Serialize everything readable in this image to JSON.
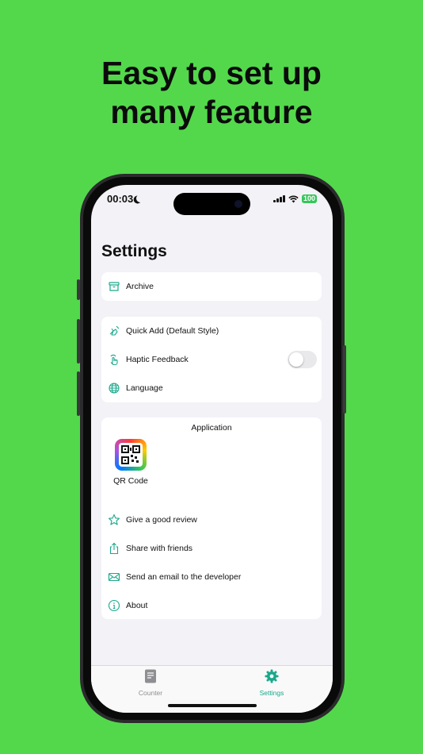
{
  "headline": {
    "line1": "Easy to set up",
    "line2": "many feature"
  },
  "status_bar": {
    "time": "00:03",
    "battery": "100"
  },
  "page_title": "Settings",
  "sections": {
    "archive": {
      "label": "Archive"
    },
    "preferences": {
      "quick_add": "Quick Add (Default Style)",
      "haptic_feedback": "Haptic Feedback",
      "haptic_enabled": false,
      "language": "Language"
    },
    "application": {
      "title": "Application",
      "qr_code_label": "QR Code",
      "items": {
        "review": "Give a good review",
        "share": "Share with friends",
        "email": "Send an email to the developer",
        "about": "About"
      }
    }
  },
  "tab_bar": {
    "counter": "Counter",
    "settings": "Settings",
    "active": "settings"
  },
  "colors": {
    "background": "#53d84c",
    "accent": "#1aa88c",
    "battery": "#34c759",
    "inactive_tab": "#8e8e93"
  }
}
